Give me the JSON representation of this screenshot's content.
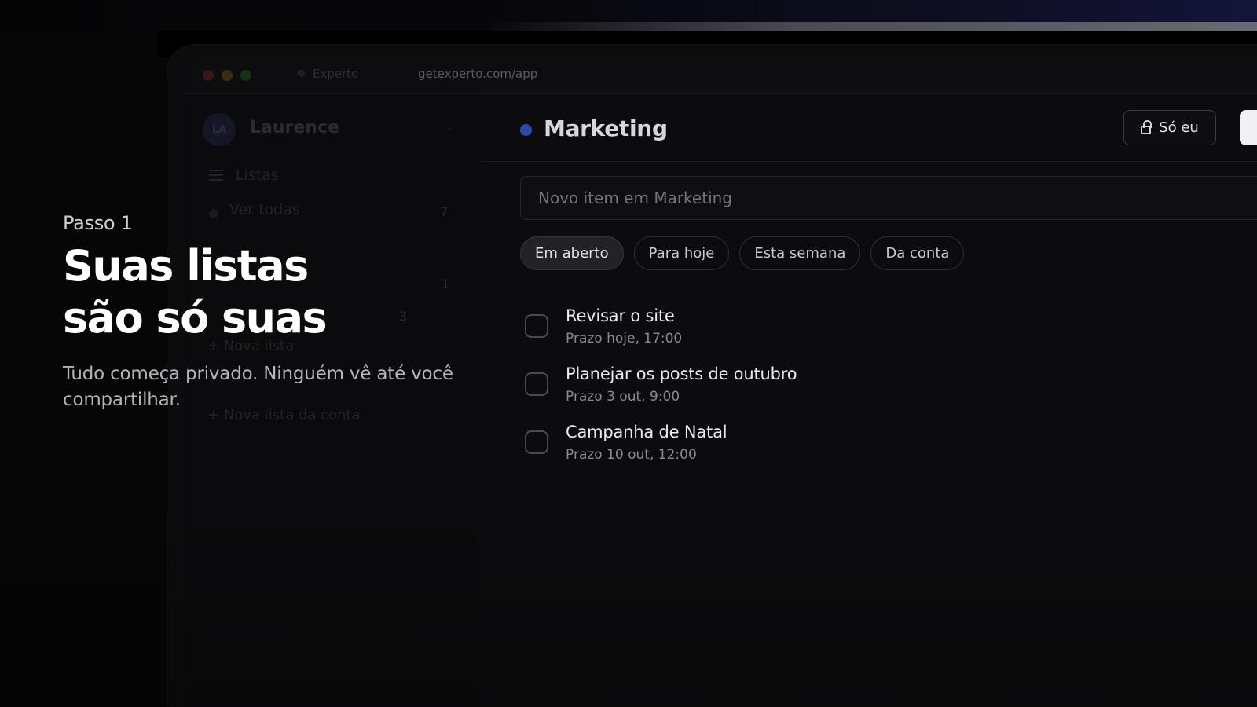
{
  "browser": {
    "tab_title": "Experto",
    "url": "getexperto.com/app"
  },
  "sidebar": {
    "avatar_initials": "LA",
    "user_name": "Laurence",
    "section_lists": "Listas",
    "view_all": "Ver todas",
    "view_all_count": "7",
    "item_count_1": "1",
    "item_count_2": "3",
    "new_list": "+ Nova lista",
    "new_account_list": "+ Nova lista da conta"
  },
  "hero": {
    "step": "Passo 1",
    "headline_line1": "Suas listas",
    "headline_line2": "são só suas",
    "subtitle": "Tudo começa privado. Ninguém vê até você compartilhar."
  },
  "main": {
    "list_title": "Marketing",
    "list_color": "#2b4aa8",
    "privacy_button": "Só eu",
    "new_item_placeholder": "Novo item em Marketing",
    "filters": [
      {
        "label": "Em aberto",
        "active": true
      },
      {
        "label": "Para hoje",
        "active": false
      },
      {
        "label": "Esta semana",
        "active": false
      },
      {
        "label": "Da conta",
        "active": false
      }
    ],
    "tasks": [
      {
        "title": "Revisar o site",
        "due": "Prazo hoje, 17:00"
      },
      {
        "title": "Planejar os posts de outubro",
        "due": "Prazo 3 out, 9:00"
      },
      {
        "title": "Campanha de Natal",
        "due": "Prazo 10 out, 12:00"
      }
    ]
  }
}
